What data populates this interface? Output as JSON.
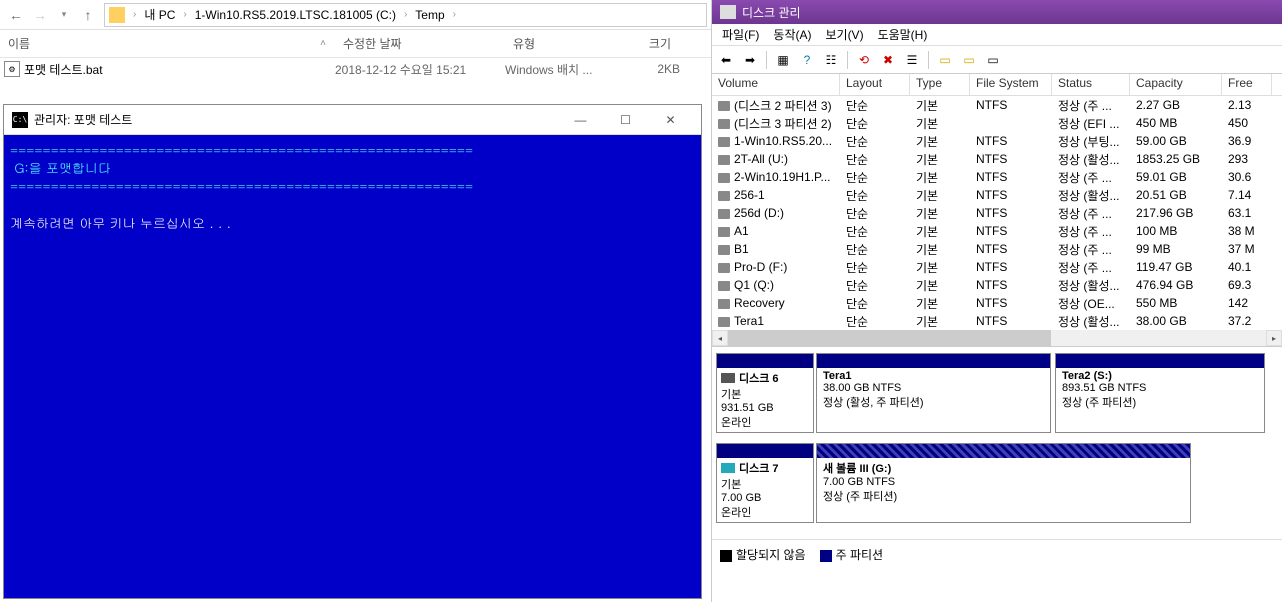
{
  "explorer": {
    "breadcrumb": [
      "내 PC",
      "1-Win10.RS5.2019.LTSC.181005 (C:)",
      "Temp"
    ],
    "columns": {
      "name": "이름",
      "date": "수정한 날짜",
      "type": "유형",
      "size": "크기"
    },
    "file": {
      "name": "포맷 테스트.bat",
      "date": "2018-12-12 수요일 15:21",
      "type": "Windows 배치 ...",
      "size": "2KB"
    }
  },
  "console": {
    "title": "관리자: 포맷 테스트",
    "sep": "=========================================================",
    "line1": " G:을 포맷합니다",
    "prompt": "계속하려면 아무 키나 누르십시오 . . ."
  },
  "diskmgmt": {
    "title": "디스크 관리",
    "menu": [
      "파일(F)",
      "동작(A)",
      "보기(V)",
      "도움말(H)"
    ],
    "columns": {
      "volume": "Volume",
      "layout": "Layout",
      "type": "Type",
      "fs": "File System",
      "status": "Status",
      "capacity": "Capacity",
      "free": "Free"
    },
    "volumes": [
      {
        "name": "(디스크 2 파티션 3)",
        "layout": "단순",
        "type": "기본",
        "fs": "NTFS",
        "status": "정상 (주 ...",
        "cap": "2.27 GB",
        "free": "2.13"
      },
      {
        "name": "(디스크 3 파티션 2)",
        "layout": "단순",
        "type": "기본",
        "fs": "",
        "status": "정상 (EFI ...",
        "cap": "450 MB",
        "free": "450"
      },
      {
        "name": "1-Win10.RS5.20...",
        "layout": "단순",
        "type": "기본",
        "fs": "NTFS",
        "status": "정상 (부팅...",
        "cap": "59.00 GB",
        "free": "36.9"
      },
      {
        "name": "2T-All (U:)",
        "layout": "단순",
        "type": "기본",
        "fs": "NTFS",
        "status": "정상 (활성...",
        "cap": "1853.25 GB",
        "free": "293"
      },
      {
        "name": "2-Win10.19H1.P...",
        "layout": "단순",
        "type": "기본",
        "fs": "NTFS",
        "status": "정상 (주 ...",
        "cap": "59.01 GB",
        "free": "30.6"
      },
      {
        "name": "256-1",
        "layout": "단순",
        "type": "기본",
        "fs": "NTFS",
        "status": "정상 (활성...",
        "cap": "20.51 GB",
        "free": "7.14"
      },
      {
        "name": "256d (D:)",
        "layout": "단순",
        "type": "기본",
        "fs": "NTFS",
        "status": "정상 (주 ...",
        "cap": "217.96 GB",
        "free": "63.1"
      },
      {
        "name": "A1",
        "layout": "단순",
        "type": "기본",
        "fs": "NTFS",
        "status": "정상 (주 ...",
        "cap": "100 MB",
        "free": "38 M"
      },
      {
        "name": "B1",
        "layout": "단순",
        "type": "기본",
        "fs": "NTFS",
        "status": "정상 (주 ...",
        "cap": "99 MB",
        "free": "37 M"
      },
      {
        "name": "Pro-D (F:)",
        "layout": "단순",
        "type": "기본",
        "fs": "NTFS",
        "status": "정상 (주 ...",
        "cap": "119.47 GB",
        "free": "40.1"
      },
      {
        "name": "Q1 (Q:)",
        "layout": "단순",
        "type": "기본",
        "fs": "NTFS",
        "status": "정상 (활성...",
        "cap": "476.94 GB",
        "free": "69.3"
      },
      {
        "name": "Recovery",
        "layout": "단순",
        "type": "기본",
        "fs": "NTFS",
        "status": "정상 (OE...",
        "cap": "550 MB",
        "free": "142"
      },
      {
        "name": "Tera1",
        "layout": "단순",
        "type": "기본",
        "fs": "NTFS",
        "status": "정상 (활성...",
        "cap": "38.00 GB",
        "free": "37.2"
      }
    ],
    "disk6": {
      "title": "디스크 6",
      "kind": "기본",
      "size": "931.51 GB",
      "state": "온라인",
      "parts": [
        {
          "name": "Tera1",
          "size": "38.00 GB NTFS",
          "status": "정상 (활성, 주 파티션)"
        },
        {
          "name": "Tera2  (S:)",
          "size": "893.51 GB NTFS",
          "status": "정상 (주 파티션)"
        }
      ]
    },
    "disk7": {
      "title": "디스크 7",
      "kind": "기본",
      "size": "7.00 GB",
      "state": "온라인",
      "parts": [
        {
          "name": "새 볼륨 III  (G:)",
          "size": "7.00 GB NTFS",
          "status": "정상 (주 파티션)"
        }
      ]
    },
    "legend": {
      "unalloc": "할당되지 않음",
      "primary": "주 파티션"
    }
  }
}
